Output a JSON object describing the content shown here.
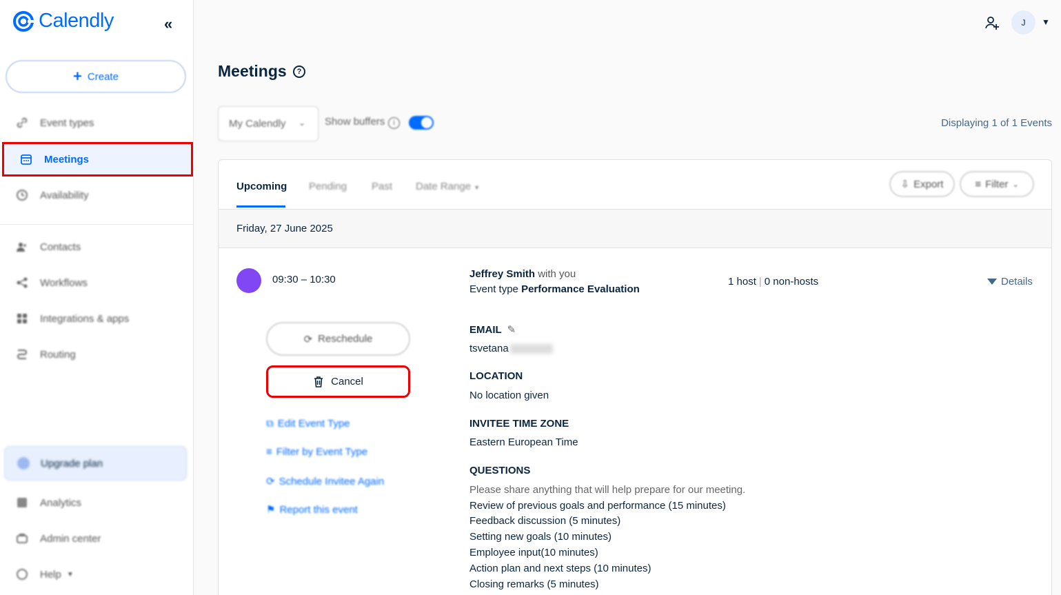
{
  "brand": {
    "name": "Calendly",
    "color": "#006bff"
  },
  "sidebar": {
    "collapse_icon": "double-chevron-left-icon",
    "create_label": "Create",
    "items": [
      {
        "label": "Event types",
        "icon": "link-icon"
      },
      {
        "label": "Meetings",
        "icon": "calendar-icon",
        "active": true
      },
      {
        "label": "Availability",
        "icon": "clock-icon"
      },
      {
        "label": "Contacts",
        "icon": "contacts-icon"
      },
      {
        "label": "Workflows",
        "icon": "workflow-icon"
      },
      {
        "label": "Integrations & apps",
        "icon": "apps-icon"
      },
      {
        "label": "Routing",
        "icon": "routing-icon"
      }
    ],
    "upgrade_label": "Upgrade plan",
    "bottom_items": [
      {
        "label": "Analytics",
        "icon": "analytics-icon"
      },
      {
        "label": "Admin center",
        "icon": "briefcase-icon"
      },
      {
        "label": "Help",
        "icon": "help-icon"
      }
    ]
  },
  "topbar": {
    "avatar_initial": "J"
  },
  "header": {
    "title": "Meetings"
  },
  "filters": {
    "calendar_select": "My Calendly",
    "show_buffers_label": "Show buffers",
    "show_buffers_on": true,
    "displaying": "Displaying 1 of 1 Events"
  },
  "tabs": [
    {
      "label": "Upcoming",
      "active": true
    },
    {
      "label": "Pending"
    },
    {
      "label": "Past"
    },
    {
      "label": "Date Range"
    }
  ],
  "actions": {
    "export": "Export",
    "filter": "Filter"
  },
  "date_header": "Friday, 27 June 2025",
  "event": {
    "time": "09:30 – 10:30",
    "color": "#8247f5",
    "invitee_name": "Jeffrey Smith",
    "invitee_suffix": "with you",
    "event_type_prefix": "Event type",
    "event_type": "Performance Evaluation",
    "hosts": "1 host",
    "non_hosts": "0 non-hosts",
    "details": "Details",
    "reschedule": "Reschedule",
    "cancel": "Cancel",
    "links": [
      "Edit Event Type",
      "Filter by Event Type",
      "Schedule Invitee Again",
      "Report this event"
    ],
    "email_label": "EMAIL",
    "email_value": "tsvetana",
    "location_label": "LOCATION",
    "location_value": "No location given",
    "timezone_label": "INVITEE TIME ZONE",
    "timezone_value": "Eastern European Time",
    "questions_label": "QUESTIONS",
    "question": "Please share anything that will help prepare for our meeting.",
    "answers": [
      "Review of previous goals and performance (15 minutes)",
      "Feedback discussion (5 minutes)",
      "Setting new goals (10 minutes)",
      "Employee input(10 minutes)",
      "Action plan and next steps (10 minutes)",
      "Closing remarks (5 minutes)"
    ]
  }
}
